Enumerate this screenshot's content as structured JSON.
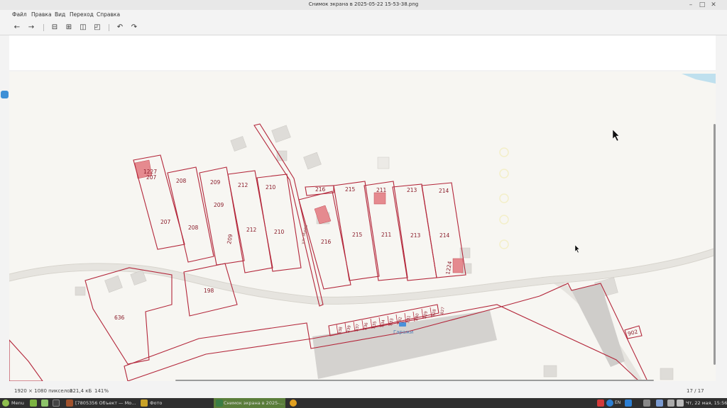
{
  "window": {
    "title": "Снимок экрана в 2025-05-22 15-53-38.png"
  },
  "menu": [
    "Файл",
    "Правка",
    "Вид",
    "Переход",
    "Справка"
  ],
  "map": {
    "parcels": {
      "p207a": "207",
      "p207b": "207",
      "p208a": "208",
      "p208b": "208",
      "p209a": "209",
      "p209b": "209",
      "p209c": "209",
      "p212a": "212",
      "p212b": "212",
      "p210a": "210",
      "p210b": "210",
      "p216a": "216",
      "p216b": "216",
      "p215a": "215",
      "p215b": "215",
      "p211a": "211",
      "p211b": "211",
      "p213a": "213",
      "p213b": "213",
      "p214a": "214",
      "p214b": "214",
      "p198": "198",
      "p636": "636",
      "p1227": "1227",
      "p1224": "1224",
      "p902": "902",
      "g1": "838",
      "g2": "839",
      "g3": "837",
      "g4": "836",
      "g5": "835",
      "g6": "834",
      "g7": "833",
      "g8": "832",
      "g9": "831",
      "g10": "830",
      "g11": "829",
      "g12": "828",
      "g13": "827"
    },
    "street_label": "ул. Мира",
    "garages_label": "Гаражи"
  },
  "status": {
    "dimensions": "1920 × 1080 пикселов",
    "size": "221,4 кБ",
    "zoom": "141%",
    "position": "17 / 17"
  },
  "taskbar": {
    "menu": "Menu",
    "task1": "[7805356 Объект — Мо...",
    "task2": "Фото",
    "task3": "Снимок экрана в 2025-...",
    "clock": "Чт, 22 мая, 15:56",
    "layout": "EN"
  },
  "colors": {
    "parcel_stroke": "#b3263a",
    "accent": "#5a7d3a",
    "taskbar": "#2f2f2f"
  }
}
